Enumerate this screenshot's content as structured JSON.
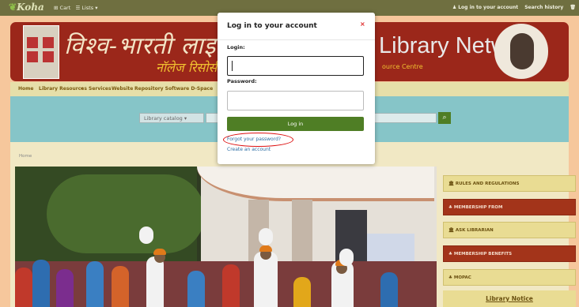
{
  "topbar": {
    "logo": "Koha",
    "cart": "Cart",
    "lists": "Lists",
    "login_link": "Log in to your account",
    "search_history": "Search history"
  },
  "banner": {
    "title_hindi": "विश्व-भारती लाइब्रेरी न",
    "subtitle_hindi": "नॉलेज रिसोर्स",
    "title_english": "Library Network",
    "subtitle_english": "ource Centre"
  },
  "nav": {
    "items": [
      "Home",
      "Library Resources",
      "Services",
      "Website",
      "Repository Software D-Space"
    ]
  },
  "search": {
    "catalog_select": "Library catalog",
    "go_icon": "search-icon"
  },
  "breadcrumb": "Home",
  "sidebar": {
    "items": [
      {
        "label": "RULES AND REGULATIONS",
        "icon": "institution-icon",
        "style": "y"
      },
      {
        "label": "MEMBERSHIP FROM",
        "icon": "users-icon",
        "style": "r"
      },
      {
        "label": "ASK LIBRARIAN",
        "icon": "institution-icon",
        "style": "y"
      },
      {
        "label": "MEMBERSHIP BENEFITS",
        "icon": "users-icon",
        "style": "r"
      },
      {
        "label": "MOPAC",
        "icon": "users-icon",
        "style": "y"
      }
    ],
    "notice": "Library Notice"
  },
  "modal": {
    "title": "Log in to your account",
    "close": "×",
    "login_label": "Login:",
    "login_value": "",
    "password_label": "Password:",
    "password_value": "",
    "login_button": "Log in",
    "forgot_link": "Forgot your password?",
    "create_link": "Create an account"
  },
  "colors": {
    "accent_green": "#4f7e25",
    "highlight_ring": "#dd1111",
    "banner_red": "#9b271a"
  }
}
